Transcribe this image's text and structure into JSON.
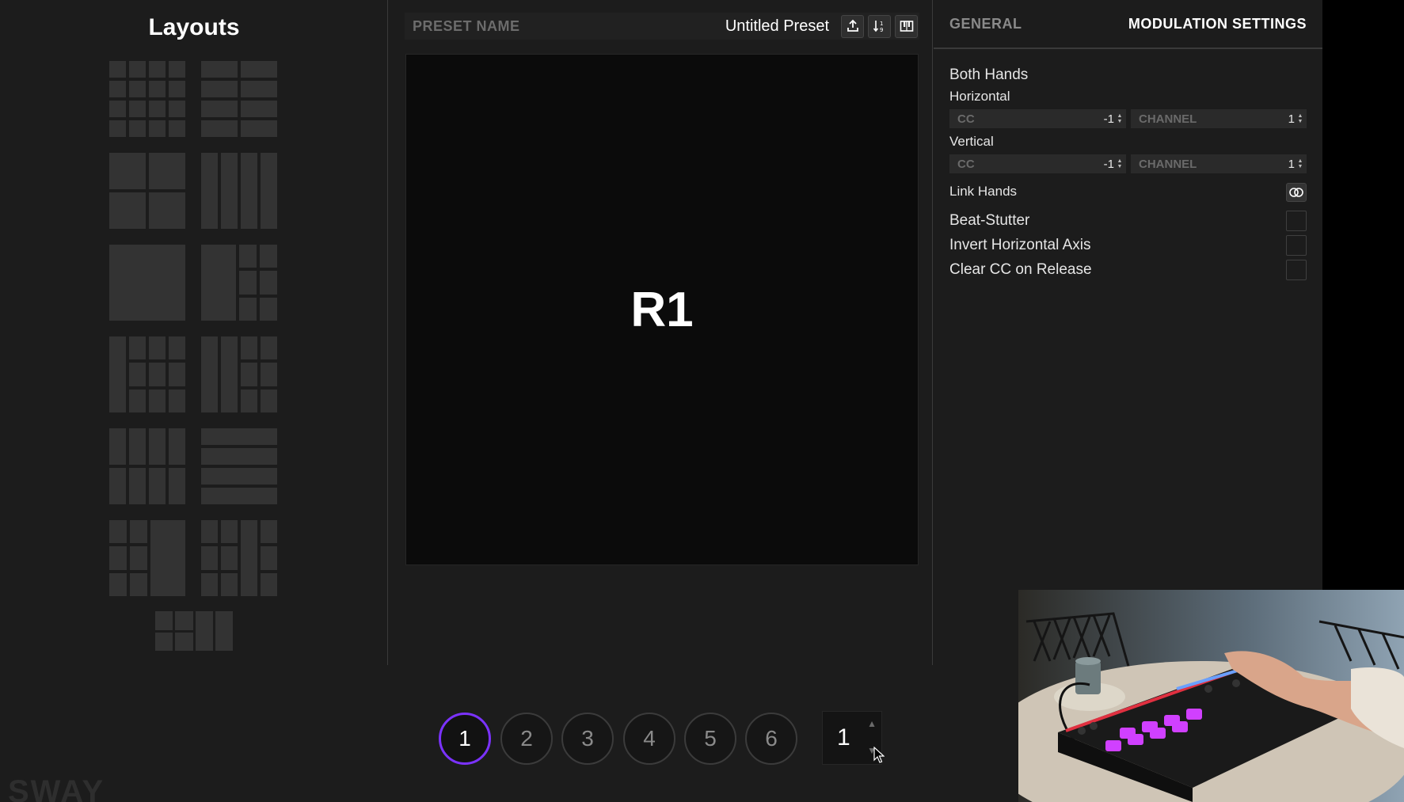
{
  "layouts": {
    "title": "Layouts",
    "items": [
      {
        "name": "layout-4x4"
      },
      {
        "name": "layout-4x2"
      },
      {
        "name": "layout-2x2"
      },
      {
        "name": "layout-4-columns"
      },
      {
        "name": "layout-single"
      },
      {
        "name": "layout-half-plus-2x3"
      },
      {
        "name": "layout-half-plus-2x3-left"
      },
      {
        "name": "layout-half-plus-2x3-right"
      },
      {
        "name": "layout-3x2-columns"
      },
      {
        "name": "layout-4-rows"
      },
      {
        "name": "layout-2x3-plus-half"
      },
      {
        "name": "layout-3x3-mixed"
      },
      {
        "name": "layout-small-mixed"
      }
    ]
  },
  "brand": "SWAY",
  "preset": {
    "label": "PRESET NAME",
    "value": "Untitled Preset",
    "icons": [
      "export-icon",
      "sort-icon",
      "keyboard-icon"
    ]
  },
  "pad": {
    "label": "R1"
  },
  "settings": {
    "tabs": {
      "general": "GENERAL",
      "modulation": "MODULATION SETTINGS",
      "active": "modulation"
    },
    "both_hands": "Both Hands",
    "horizontal": {
      "label": "Horizontal",
      "cc_label": "CC",
      "cc_value": "-1",
      "channel_label": "CHANNEL",
      "channel_value": "1"
    },
    "vertical": {
      "label": "Vertical",
      "cc_label": "CC",
      "cc_value": "-1",
      "channel_label": "CHANNEL",
      "channel_value": "1"
    },
    "link_hands": "Link Hands",
    "beat_stutter": "Beat-Stutter",
    "invert_horizontal": "Invert Horizontal Axis",
    "clear_cc": "Clear CC on Release"
  },
  "pages": {
    "items": [
      "1",
      "2",
      "3",
      "4",
      "5",
      "6"
    ],
    "active": "1",
    "stepper_value": "1"
  },
  "colors": {
    "accent": "#7b32ff",
    "background": "#1c1c1c",
    "pad_background": "#0b0b0b",
    "layout_cell": "#333333"
  }
}
